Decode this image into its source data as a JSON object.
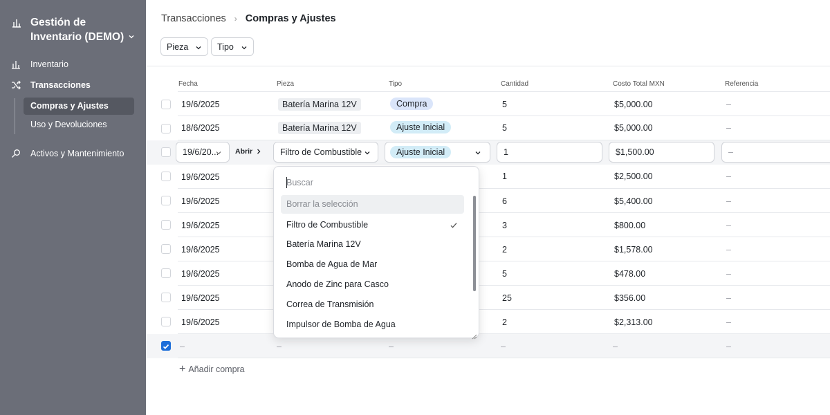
{
  "sidebar": {
    "app_title": "Gestión de Inventario (DEMO)",
    "items": [
      {
        "label": "Inventario",
        "icon": "bar-chart-icon"
      },
      {
        "label": "Transacciones",
        "icon": "shuffle-icon"
      },
      {
        "label": "Activos y Mantenimiento",
        "icon": "search-icon"
      }
    ],
    "sub_items": [
      {
        "label": "Compras y Ajustes",
        "active": true
      },
      {
        "label": "Uso y Devoluciones",
        "active": false
      }
    ]
  },
  "header": {
    "breadcrumb_parent": "Transacciones",
    "breadcrumb_current": "Compras y Ajustes",
    "filters": [
      "Pieza",
      "Tipo"
    ]
  },
  "table": {
    "columns": [
      "Fecha",
      "Pieza",
      "Tipo",
      "Cantidad",
      "Costo Total MXN",
      "Referencia"
    ],
    "rows": [
      {
        "fecha": "19/6/2025",
        "pieza": "Batería Marina 12V",
        "tipo": "Compra",
        "cantidad": "5",
        "costo": "$5,000.00",
        "referencia": "–"
      },
      {
        "fecha": "18/6/2025",
        "pieza": "Batería Marina 12V",
        "tipo": "Ajuste Inicial",
        "cantidad": "5",
        "costo": "$5,000.00",
        "referencia": "–"
      },
      {
        "fecha": "19/6/2025",
        "cantidad": "1",
        "costo": "$2,500.00",
        "referencia": "–"
      },
      {
        "fecha": "19/6/2025",
        "cantidad": "6",
        "costo": "$5,400.00",
        "referencia": "–"
      },
      {
        "fecha": "19/6/2025",
        "cantidad": "3",
        "costo": "$800.00",
        "referencia": "–"
      },
      {
        "fecha": "19/6/2025",
        "cantidad": "2",
        "costo": "$1,578.00",
        "referencia": "–"
      },
      {
        "fecha": "19/6/2025",
        "cantidad": "5",
        "costo": "$478.00",
        "referencia": "–"
      },
      {
        "fecha": "19/6/2025",
        "cantidad": "25",
        "costo": "$356.00",
        "referencia": "–"
      },
      {
        "fecha": "19/6/2025",
        "cantidad": "2",
        "costo": "$2,313.00",
        "referencia": "–"
      }
    ],
    "editing_row": {
      "fecha": "19/6/20...",
      "open_label": "Abrir",
      "pieza": "Filtro de Combustible",
      "tipo": "Ajuste Inicial",
      "cantidad": "1",
      "costo": "$1,500.00",
      "referencia": "–"
    },
    "new_row": {
      "fecha": "–",
      "pieza": "–",
      "tipo": "–",
      "cantidad": "–",
      "costo": "–",
      "referencia": "–"
    },
    "add_label": "Añadir compra"
  },
  "dropdown": {
    "search_placeholder": "Buscar",
    "clear_label": "Borrar la selección",
    "options": [
      "Filtro de Combustible",
      "Batería Marina 12V",
      "Bomba de Agua de Mar",
      "Anodo de Zinc para Casco",
      "Correa de Transmisión",
      "Impulsor de Bomba de Agua"
    ],
    "selected": "Filtro de Combustible"
  },
  "colors": {
    "sidebar_bg": "#6b6e78",
    "accent": "#1e6fd9",
    "compra_pill": "#dae5fa",
    "ajuste_pill": "#d2ecf7"
  }
}
